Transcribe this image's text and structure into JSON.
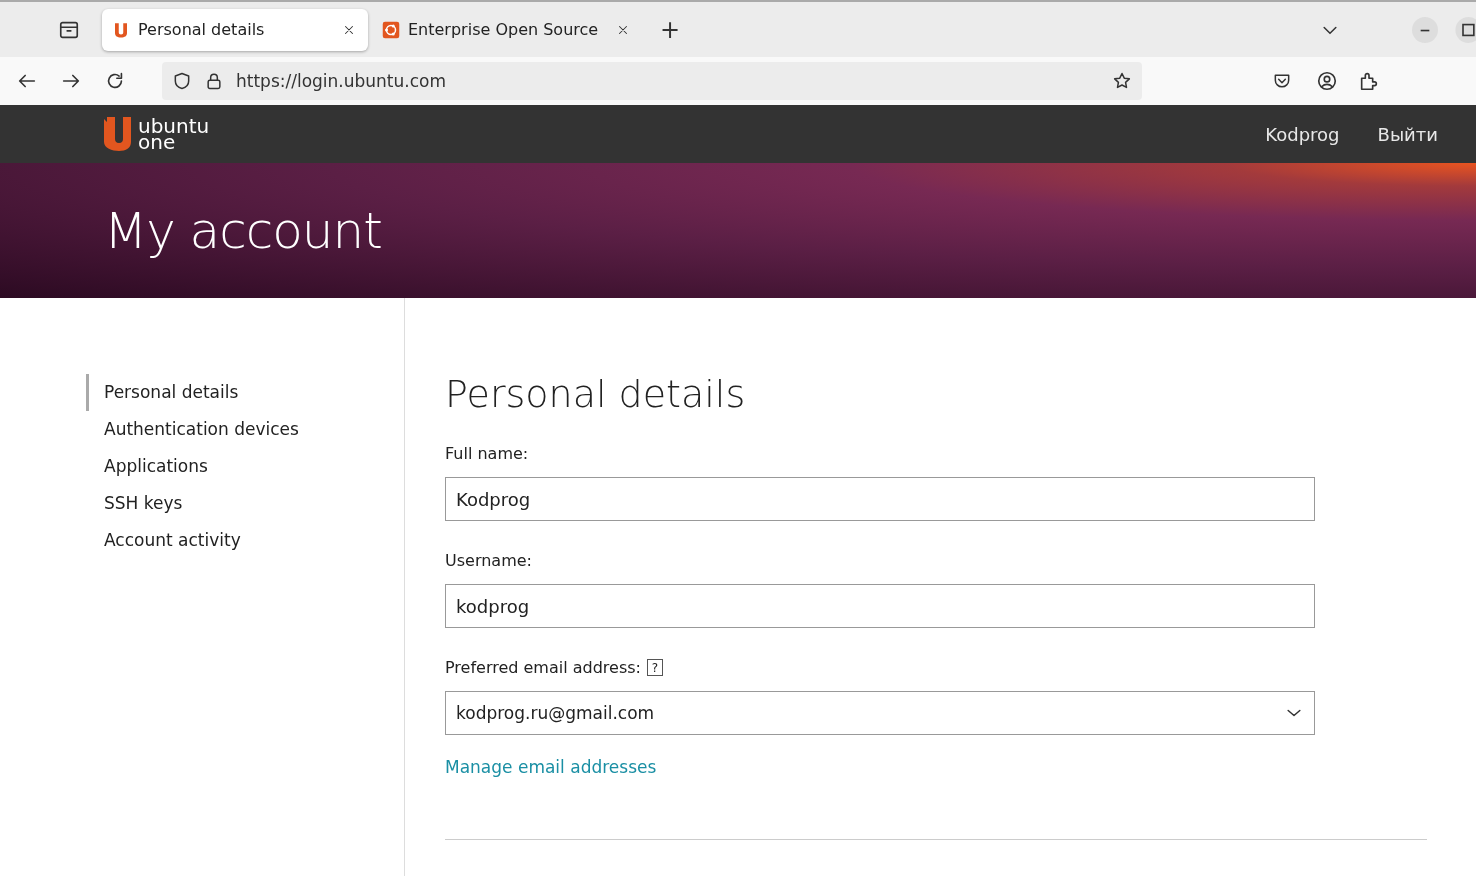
{
  "browser": {
    "tabs": [
      {
        "title": "Personal details",
        "kind": "account",
        "selected": true
      },
      {
        "title": "Enterprise Open Source",
        "kind": "product",
        "selected": false
      }
    ],
    "new_tab": "+",
    "url": "https://login.ubuntu.com"
  },
  "header": {
    "logo_line_1": "ubuntu",
    "logo_line_2": "one",
    "links": [
      "Kodprog",
      "Выйти"
    ]
  },
  "hero": {
    "title": "My account"
  },
  "sidebar": {
    "items": [
      {
        "label": "Personal details",
        "selected": true
      },
      {
        "label": "Authentication devices",
        "selected": false
      },
      {
        "label": "Applications",
        "selected": false
      },
      {
        "label": "SSH keys",
        "selected": false
      },
      {
        "label": "Account activity",
        "selected": false
      }
    ]
  },
  "form": {
    "heading": "Personal details",
    "fields": [
      {
        "kind": "text",
        "label": "Full name:",
        "value": "Kodprog"
      },
      {
        "kind": "text",
        "label": "Username:",
        "value": "kodprog"
      },
      {
        "kind": "select",
        "label": "Preferred email address:",
        "help": "?",
        "value": "kodprog.ru@gmail.com"
      }
    ],
    "link": "Manage email addresses"
  }
}
